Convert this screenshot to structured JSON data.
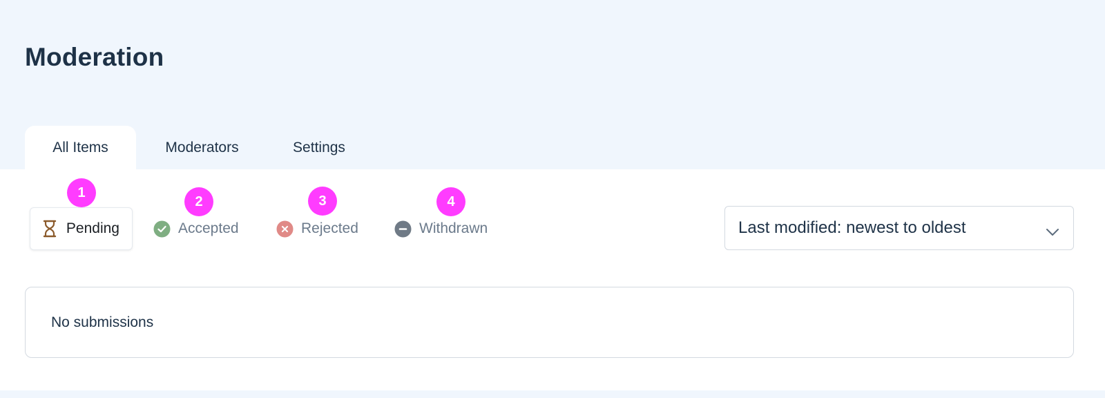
{
  "page": {
    "title": "Moderation"
  },
  "tabs": [
    {
      "label": "All Items",
      "active": true
    },
    {
      "label": "Moderators",
      "active": false
    },
    {
      "label": "Settings",
      "active": false
    }
  ],
  "filters": [
    {
      "label": "Pending",
      "icon": "hourglass-icon",
      "color": "#8b5a2b",
      "active": true,
      "marker": "1"
    },
    {
      "label": "Accepted",
      "icon": "check-circle-icon",
      "color": "#7fae82",
      "active": false,
      "marker": "2"
    },
    {
      "label": "Rejected",
      "icon": "x-circle-icon",
      "color": "#e08a87",
      "active": false,
      "marker": "3"
    },
    {
      "label": "Withdrawn",
      "icon": "minus-circle-icon",
      "color": "#6f7a86",
      "active": false,
      "marker": "4"
    }
  ],
  "sort": {
    "value": "Last modified: newest to oldest"
  },
  "results": {
    "empty_text": "No submissions"
  },
  "colors": {
    "marker": "#ff3cff",
    "header_bg": "#f0f6fd",
    "title": "#1e3247"
  }
}
